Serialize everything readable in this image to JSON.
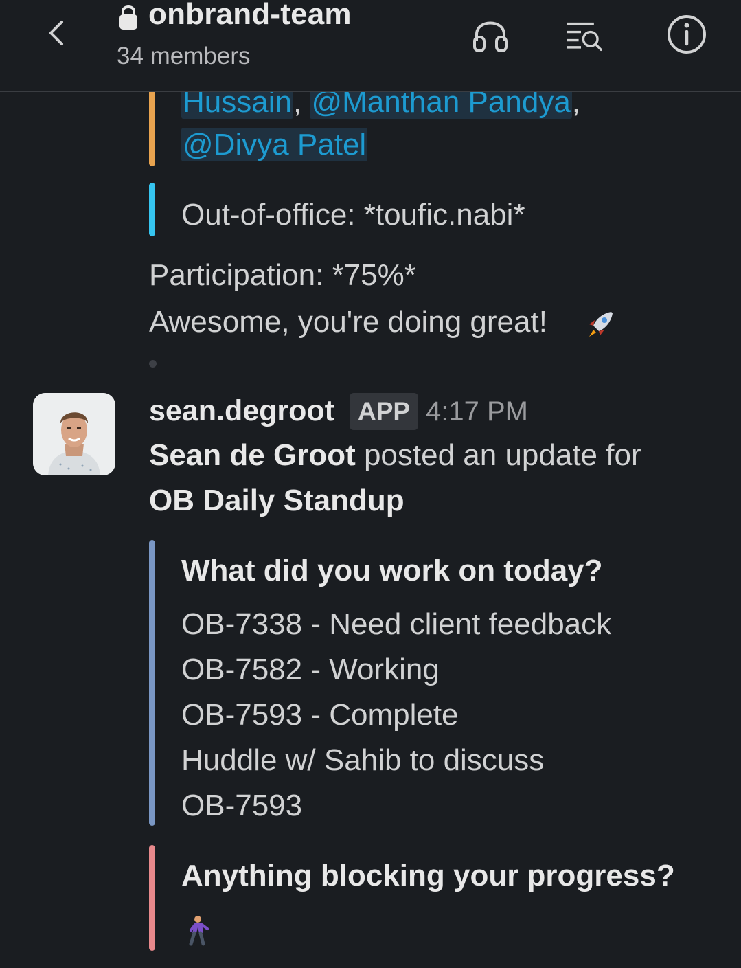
{
  "header": {
    "channel_name": "onbrand-team",
    "member_count": "34 members"
  },
  "previous_message": {
    "mentions_line1_a": "Hussain",
    "mentions_line1_sep": ",",
    "mentions_line1_b": "@Manthan Pandya",
    "mentions_line1_end": ",",
    "mentions_line2": "@Divya Patel",
    "out_of_office": "Out-of-office: *toufic.nabi*",
    "participation": "Participation: *75%*",
    "encouragement": "Awesome, you're doing great!",
    "encouragement_emoji": "rocket-emoji"
  },
  "message": {
    "username": "sean.degroot",
    "badge": "APP",
    "time": "4:17 PM",
    "author_name": "Sean de Groot",
    "posted_text": " posted an update for",
    "standup_name": "OB Daily Standup",
    "sections": [
      {
        "question": "What did you work on today?",
        "lines": [
          "OB-7338 - Need client feedback",
          "OB-7582 - Working",
          "OB-7593 - Complete",
          "Huddle w/ Sahib to discuss",
          "OB-7593"
        ]
      },
      {
        "question": "Anything blocking your progress?",
        "answer_emoji": "person-walking-emoji"
      }
    ]
  },
  "colors": {
    "background": "#1a1d21",
    "orange_bar": "#e8a34f",
    "cyan_bar": "#36c5f0",
    "blue_bar": "#7a97c4",
    "pink_bar": "#e8898c",
    "mention": "#1d9bd1"
  }
}
